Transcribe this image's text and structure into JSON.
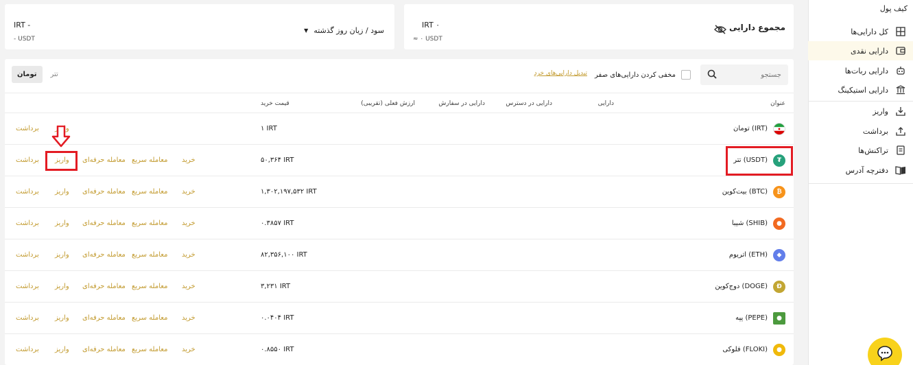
{
  "sidebar": {
    "title": "کیف پول",
    "items": [
      {
        "label": "کل دارایی‌ها",
        "icon": "grid-icon"
      },
      {
        "label": "دارایی نقدی",
        "icon": "wallet-icon",
        "active": true
      },
      {
        "label": "دارایی ربات‌ها",
        "icon": "robot-icon"
      },
      {
        "label": "دارایی استیکینگ",
        "icon": "bank-icon"
      },
      {
        "label": "واریز",
        "icon": "download-icon"
      },
      {
        "label": "برداشت",
        "icon": "upload-icon"
      },
      {
        "label": "تراکنش‌ها",
        "icon": "receipt-icon"
      },
      {
        "label": "دفترچه آدرس",
        "icon": "book-icon"
      }
    ]
  },
  "total_card": {
    "label": "مجموع دارایی",
    "irt": "IRT ۰",
    "usdt": "≈ ۰ USDT"
  },
  "profit_card": {
    "selector": "سود / زیان روز گذشته",
    "irt": "IRT -",
    "usdt": "- USDT"
  },
  "toolbar": {
    "search_placeholder": "جستجو",
    "hide_zero": "مخفی کردن دارایی‌های صفر",
    "convert_small": "تبدیل دارایی‌های خرد",
    "tab_toman": "تومان",
    "tab_tether": "تتر"
  },
  "table": {
    "headers": {
      "title": "عنوان",
      "asset": "دارایی",
      "available": "دارایی در دسترس",
      "in_order": "دارایی در سفارش",
      "value": "ارزش فعلی (تقریبی)",
      "buy_price": "قیمت خرید"
    },
    "actions": {
      "buy": "خرید",
      "quick": "معامله سریع",
      "pro": "معامله حرفه‌ای",
      "deposit": "واریز",
      "withdraw": "برداشت"
    },
    "rows": [
      {
        "name": "تومان (IRT)",
        "price": "۱ IRT",
        "coin_color": "#ffffff",
        "coin_icon": "iran-flag-icon"
      },
      {
        "name": "تتر (USDT)",
        "price": "۵۰,۳۶۴ IRT",
        "coin_color": "#26a17b",
        "coin_icon": "tether-icon"
      },
      {
        "name": "بیت‌کوین (BTC)",
        "price": "۱,۳۰۲,۱۹۷,۵۳۲ IRT",
        "coin_color": "#f7931a",
        "coin_icon": "bitcoin-icon"
      },
      {
        "name": "شیبا (SHIB)",
        "price": "۰.۳۸۵۷ IRT",
        "coin_color": "#f26a21",
        "coin_icon": "shiba-icon"
      },
      {
        "name": "اتریوم (ETH)",
        "price": "۸۲,۳۵۶,۱۰۰ IRT",
        "coin_color": "#627eea",
        "coin_icon": "ethereum-icon"
      },
      {
        "name": "دوج‌کوین (DOGE)",
        "price": "۳,۲۳۱ IRT",
        "coin_color": "#c2a633",
        "coin_icon": "doge-icon"
      },
      {
        "name": "پپه (PEPE)",
        "price": "۰.۰۴۰۴ IRT",
        "coin_color": "#4c9a3e",
        "coin_icon": "pepe-icon"
      },
      {
        "name": "فلوکی (FLOKI)",
        "price": "۰.۸۵۵۰ IRT",
        "coin_color": "#f0b90b",
        "coin_icon": "floki-icon"
      }
    ]
  },
  "colors": {
    "accent": "#c29a2e",
    "highlight": "#e31b23",
    "chat": "#f8d21b"
  }
}
